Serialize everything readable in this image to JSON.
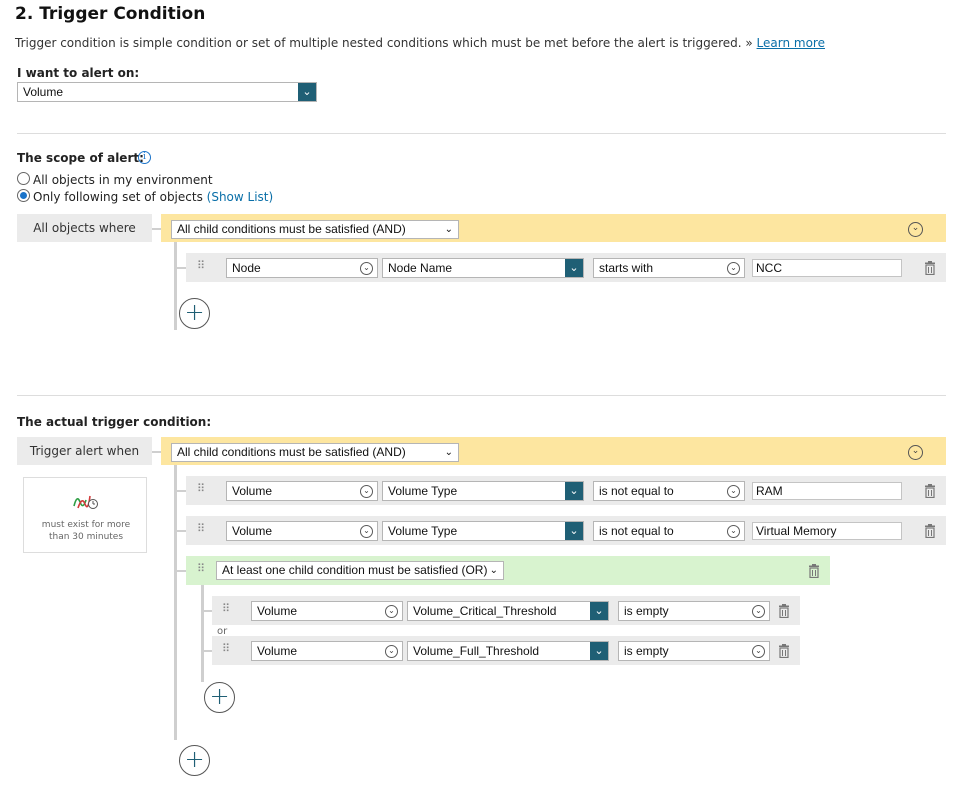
{
  "header": {
    "title": "2. Trigger Condition",
    "description": "Trigger condition is simple condition or set of multiple nested conditions which must be met before the alert is triggered. »",
    "learn_more": "Learn more"
  },
  "alert_on": {
    "label": "I want to alert on:",
    "value": "Volume"
  },
  "scope": {
    "label": "The scope of alert:",
    "option_all": "All objects in my environment",
    "option_following": "Only following set of objects",
    "show_list": "(Show List)",
    "selected": "following",
    "group_label": "All objects where",
    "group_operator": "All child conditions must be satisfied (AND)",
    "conditions": [
      {
        "object": "Node",
        "field": "Node Name",
        "operator": "starts with",
        "value": "NCC"
      }
    ]
  },
  "trigger": {
    "label": "The actual trigger condition:",
    "group_label": "Trigger alert when",
    "group_operator": "All child conditions must be satisfied (AND)",
    "time_note": "must exist for more than 30 minutes",
    "conditions": [
      {
        "object": "Volume",
        "field": "Volume Type",
        "operator": "is not equal to",
        "value": "RAM"
      },
      {
        "object": "Volume",
        "field": "Volume Type",
        "operator": "is not equal to",
        "value": "Virtual Memory"
      }
    ],
    "nested": {
      "operator": "At least one child condition must be satisfied (OR)",
      "joiner": "or",
      "conditions": [
        {
          "object": "Volume",
          "field": "Volume_Critical_Threshold",
          "operator": "is empty"
        },
        {
          "object": "Volume",
          "field": "Volume_Full_Threshold",
          "operator": "is empty"
        }
      ]
    }
  },
  "icons": {
    "dropdown": "chevron-down-icon",
    "trash": "trash-icon",
    "add": "plus-icon",
    "info": "info-icon",
    "grip": "drag-handle-icon"
  },
  "colors": {
    "accent": "#1f5f75",
    "and_bar": "#fde6a0",
    "or_bar": "#d8f3cf",
    "row_bg": "#ebebeb",
    "link": "#0a6fa8"
  }
}
